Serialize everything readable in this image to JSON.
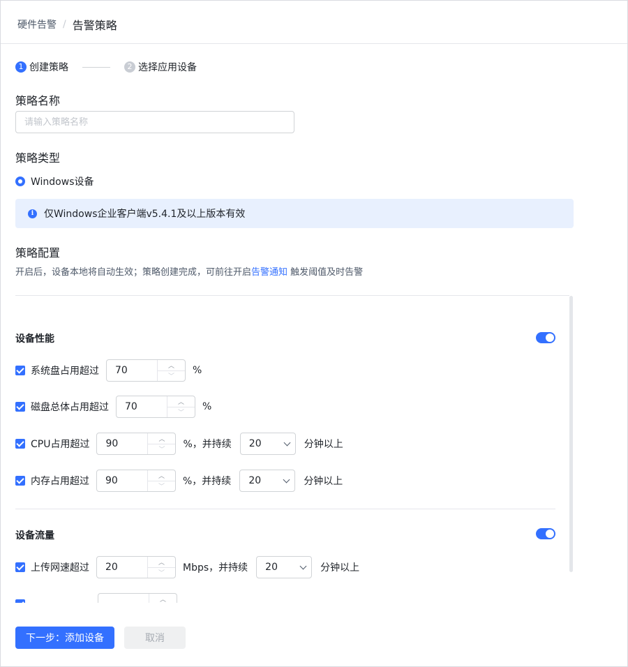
{
  "breadcrumb": {
    "parent": "硬件告警",
    "separator": "/",
    "current": "告警策略"
  },
  "steps": [
    {
      "num": "1",
      "label": "创建策略"
    },
    {
      "num": "2",
      "label": "选择应用设备"
    }
  ],
  "policy_name": {
    "title": "策略名称",
    "placeholder": "请输入策略名称",
    "value": ""
  },
  "policy_type": {
    "title": "策略类型",
    "option": "Windows设备",
    "notice": "仅Windows企业客户端v5.4.1及以上版本有效"
  },
  "policy_config": {
    "title": "策略配置",
    "desc_prefix": "开启后，设备本地将自动生效；策略创建完成，可前往开启",
    "desc_link": "告警通知",
    "desc_suffix": " 触发阈值及时告警"
  },
  "performance": {
    "title": "设备性能",
    "enabled": true,
    "rows": [
      {
        "label": "系统盘占用超过",
        "value": "70",
        "unit": "%"
      },
      {
        "label": "磁盘总体占用超过",
        "value": "70",
        "unit": "%"
      },
      {
        "label": "CPU占用超过",
        "value": "90",
        "unit": "%，并持续",
        "duration": "20",
        "duration_unit": "分钟以上"
      },
      {
        "label": "内存占用超过",
        "value": "90",
        "unit": "%，并持续",
        "duration": "20",
        "duration_unit": "分钟以上"
      }
    ]
  },
  "traffic": {
    "title": "设备流量",
    "enabled": true,
    "rows": [
      {
        "label": "上传网速超过",
        "value": "20",
        "unit": "Mbps，并持续",
        "duration": "20",
        "duration_unit": "分钟以上"
      }
    ]
  },
  "footer": {
    "next_label": "下一步：添加设备",
    "cancel_label": "取消"
  },
  "colors": {
    "primary": "#3370ff",
    "notice_bg": "#e8f0fe"
  }
}
